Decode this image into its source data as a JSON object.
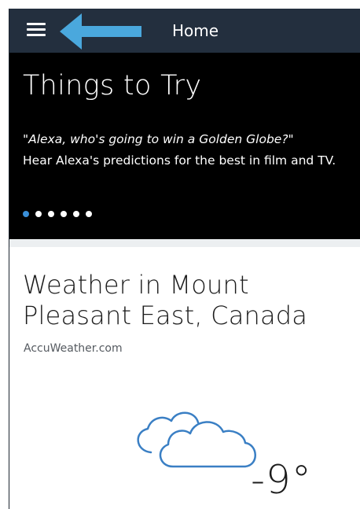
{
  "header": {
    "title": "Home",
    "menu_icon": "hamburger-menu-icon",
    "callout_icon": "left-arrow-callout-icon",
    "callout_color": "#4aa8dd",
    "background_color": "#232f3e"
  },
  "things_to_try": {
    "heading": "Things to Try",
    "quote": "\"Alexa, who's going to win a Golden Globe?\"",
    "description": "Hear Alexa's predictions for the best in film and TV.",
    "carousel_dots": 6,
    "active_dot": 1,
    "active_dot_color": "#3a8fd8"
  },
  "weather": {
    "title": "Weather in Mount Pleasant East, Canada",
    "source": "AccuWeather.com",
    "condition_icon": "cloudy-icon",
    "icon_color": "#3a7fc4",
    "temperature": "-9°"
  }
}
